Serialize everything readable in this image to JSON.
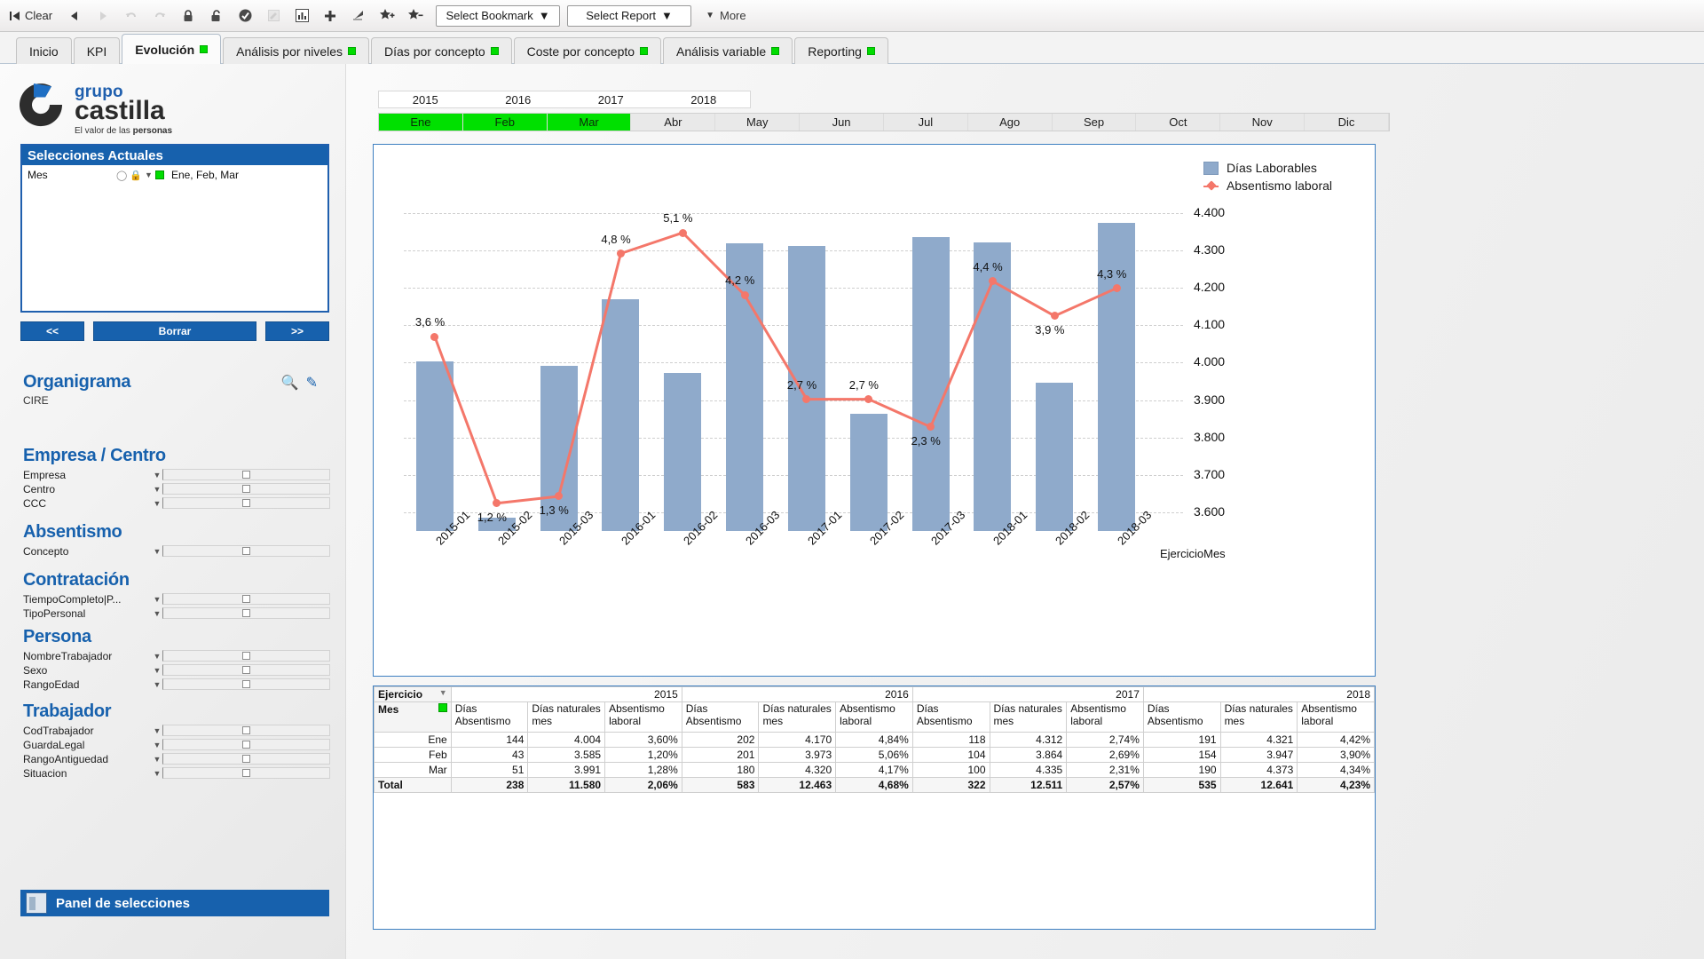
{
  "toolbar": {
    "clear_label": "Clear",
    "buttons": [
      {
        "name": "back-button",
        "icon": "triangle-left-icon",
        "disabled": false
      },
      {
        "name": "forward-button",
        "icon": "triangle-right-icon",
        "disabled": true
      },
      {
        "name": "undo-button",
        "icon": "undo-arrow-icon",
        "disabled": true
      },
      {
        "name": "redo-button",
        "icon": "redo-arrow-icon",
        "disabled": true
      },
      {
        "name": "lock-button",
        "icon": "lock-closed-icon",
        "disabled": false
      },
      {
        "name": "unlock-button",
        "icon": "lock-open-icon",
        "disabled": false
      },
      {
        "name": "check-circle-button",
        "icon": "check-circle-icon",
        "disabled": false
      },
      {
        "name": "edit-note-button",
        "icon": "pencil-note-icon",
        "disabled": true
      },
      {
        "name": "chart-button",
        "icon": "bar-chart-icon",
        "disabled": false
      },
      {
        "name": "add-button",
        "icon": "plus-icon",
        "disabled": false
      },
      {
        "name": "pointer-button",
        "icon": "flag-pointer-icon",
        "disabled": false
      },
      {
        "name": "add-bookmark-button",
        "icon": "star-plus-icon",
        "disabled": false
      },
      {
        "name": "remove-bookmark-button",
        "icon": "star-minus-icon",
        "disabled": false
      }
    ],
    "select_bookmark": "Select Bookmark",
    "select_report": "Select Report",
    "more_label": "More"
  },
  "tabs": [
    {
      "label": "Inicio",
      "active": false,
      "dot": false
    },
    {
      "label": "KPI",
      "active": false,
      "dot": false
    },
    {
      "label": "Evolución",
      "active": true,
      "dot": true
    },
    {
      "label": "Análisis por niveles",
      "active": false,
      "dot": true
    },
    {
      "label": "Días por concepto",
      "active": false,
      "dot": true
    },
    {
      "label": "Coste por concepto",
      "active": false,
      "dot": true
    },
    {
      "label": "Análisis variable",
      "active": false,
      "dot": true
    },
    {
      "label": "Reporting",
      "active": false,
      "dot": true
    }
  ],
  "logo": {
    "grupo": "grupo",
    "castilla": "castilla",
    "tagline_prefix": "El valor de las ",
    "tagline_bold": "personas"
  },
  "selections": {
    "title": "Selecciones Actuales",
    "rows": [
      {
        "field": "Mes",
        "values": "Ene, Feb, Mar"
      }
    ],
    "buttons": {
      "prev": "<<",
      "clear": "Borrar",
      "next": ">>"
    }
  },
  "sidebar_sections": [
    {
      "title": "Organigrama",
      "plain": "CIRE",
      "tools": [
        "search-icon",
        "eraser-icon"
      ],
      "fields": []
    },
    {
      "title": "Empresa / Centro",
      "fields": [
        "Empresa",
        "Centro",
        "CCC"
      ]
    },
    {
      "title": "Absentismo",
      "fields": [
        "Concepto"
      ]
    },
    {
      "title": "Contratación",
      "fields": [
        "TiempoCompleto|P...",
        "TipoPersonal"
      ]
    },
    {
      "title": "Persona",
      "fields": [
        "NombreTrabajador",
        "Sexo",
        "RangoEdad"
      ]
    },
    {
      "title": "Trabajador",
      "fields": [
        "CodTrabajador",
        "GuardaLegal",
        "RangoAntiguedad",
        "Situacion"
      ]
    }
  ],
  "panel_selecciones_label": "Panel de selecciones",
  "year_filter": {
    "values": [
      "2015",
      "2016",
      "2017",
      "2018"
    ],
    "selected": []
  },
  "month_filter": {
    "values": [
      "Ene",
      "Feb",
      "Mar",
      "Abr",
      "May",
      "Jun",
      "Jul",
      "Ago",
      "Sep",
      "Oct",
      "Nov",
      "Dic"
    ],
    "selected": [
      "Ene",
      "Feb",
      "Mar"
    ]
  },
  "chart_data": {
    "type": "bar",
    "title": "",
    "xlabel": "EjercicioMes",
    "ylabel": "",
    "ylim": [
      3550,
      4440
    ],
    "yticks": [
      "3.600",
      "3.700",
      "3.800",
      "3.900",
      "4.000",
      "4.100",
      "4.200",
      "4.300",
      "4.400"
    ],
    "ytick_values": [
      3600,
      3700,
      3800,
      3900,
      4000,
      4100,
      4200,
      4300,
      4400
    ],
    "grid": true,
    "legend_position": "top-right",
    "categories": [
      "2015-01",
      "2015-02",
      "2015-03",
      "2016-01",
      "2016-02",
      "2016-03",
      "2017-01",
      "2017-02",
      "2017-03",
      "2018-01",
      "2018-02",
      "2018-03"
    ],
    "series": [
      {
        "name": "Días Laborables",
        "type": "bar",
        "color": "#8faacb",
        "values": [
          4004,
          3585,
          3991,
          4170,
          3973,
          4320,
          4312,
          3864,
          4335,
          4321,
          3947,
          4373
        ]
      },
      {
        "name": "Absentismo laboral",
        "type": "line",
        "color": "#f4776a",
        "axis": "secondary",
        "values": [
          3.6,
          1.2,
          1.3,
          4.8,
          5.1,
          4.2,
          2.7,
          2.7,
          2.3,
          4.4,
          3.9,
          4.3
        ],
        "labels": [
          "3,6 %",
          "1,2 %",
          "1,3 %",
          "4,8 %",
          "5,1 %",
          "4,2 %",
          "2,7 %",
          "2,7 %",
          "2,3 %",
          "4,4 %",
          "3,9 %",
          "4,3 %"
        ],
        "ylim": [
          0.8,
          5.6
        ]
      }
    ]
  },
  "pivot_table": {
    "dim_row_label": "Ejercicio",
    "dim_col_label": "Mes",
    "years": [
      "2015",
      "2016",
      "2017",
      "2018"
    ],
    "measures": [
      "Días Absentismo",
      "Días naturales mes",
      "Absentismo laboral"
    ],
    "rows": [
      {
        "label": "Ene",
        "cells": [
          "144",
          "4.004",
          "3,60%",
          "202",
          "4.170",
          "4,84%",
          "118",
          "4.312",
          "2,74%",
          "191",
          "4.321",
          "4,42%"
        ]
      },
      {
        "label": "Feb",
        "cells": [
          "43",
          "3.585",
          "1,20%",
          "201",
          "3.973",
          "5,06%",
          "104",
          "3.864",
          "2,69%",
          "154",
          "3.947",
          "3,90%"
        ]
      },
      {
        "label": "Mar",
        "cells": [
          "51",
          "3.991",
          "1,28%",
          "180",
          "4.320",
          "4,17%",
          "100",
          "4.335",
          "2,31%",
          "190",
          "4.373",
          "4,34%"
        ]
      }
    ],
    "total": {
      "label": "Total",
      "cells": [
        "238",
        "11.580",
        "2,06%",
        "583",
        "12.463",
        "4,68%",
        "322",
        "12.511",
        "2,57%",
        "535",
        "12.641",
        "4,23%"
      ]
    }
  }
}
